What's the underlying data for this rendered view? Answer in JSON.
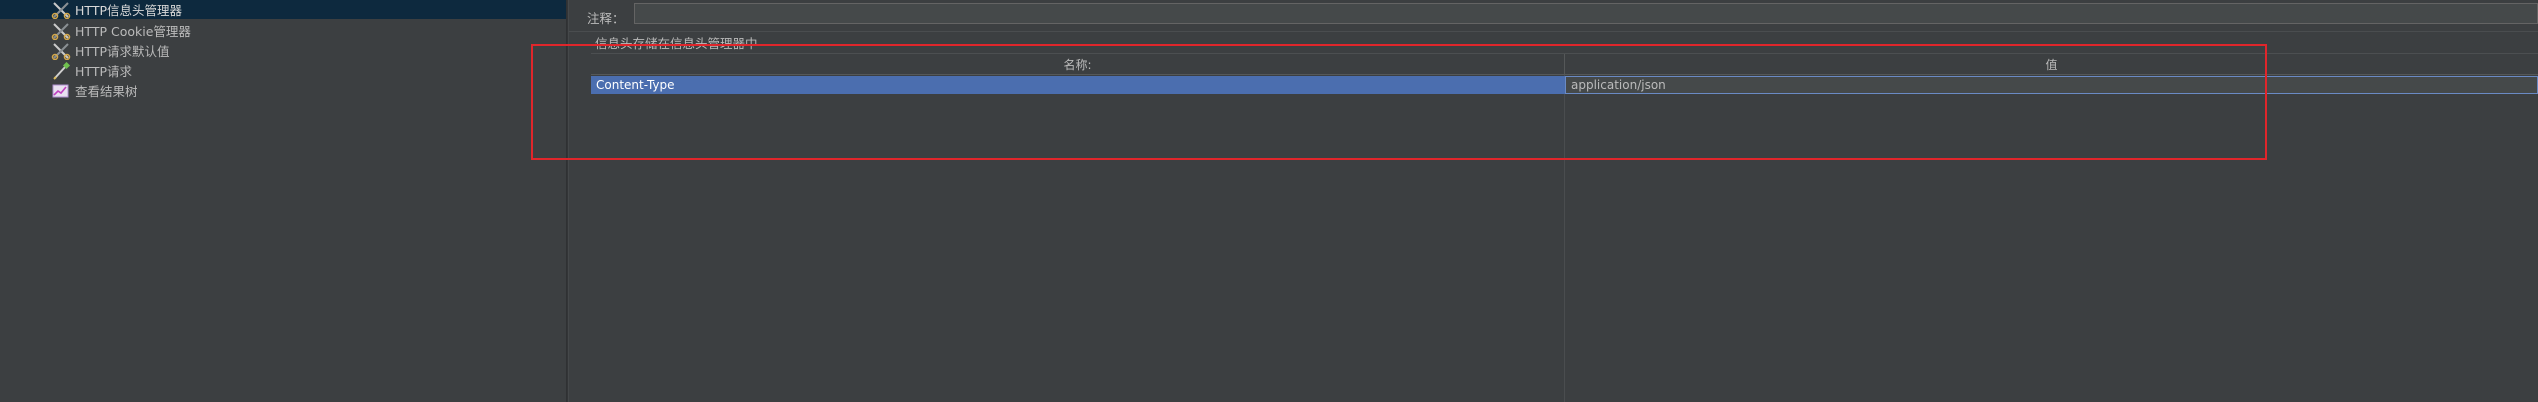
{
  "tree": {
    "items": [
      {
        "label": "HTTP信息头管理器",
        "icon": "scissors-icon",
        "selected": true
      },
      {
        "label": "HTTP Cookie管理器",
        "icon": "scissors-icon",
        "selected": false
      },
      {
        "label": "HTTP请求默认值",
        "icon": "scissors-icon",
        "selected": false
      },
      {
        "label": "HTTP请求",
        "icon": "pipette-icon",
        "selected": false
      },
      {
        "label": "查看结果树",
        "icon": "chart-icon",
        "selected": false
      }
    ]
  },
  "editor": {
    "comment_label": "注释：",
    "comment_value": "",
    "section_title": "信息头存储在信息头管理器中"
  },
  "table": {
    "columns": [
      "名称:",
      "值"
    ],
    "rows": [
      {
        "name": "Content-Type",
        "value": "application/json"
      }
    ]
  },
  "colors": {
    "selection": "#4b6eaf",
    "highlight_box": "#e0262b",
    "tree_selected": "#0d293e"
  }
}
